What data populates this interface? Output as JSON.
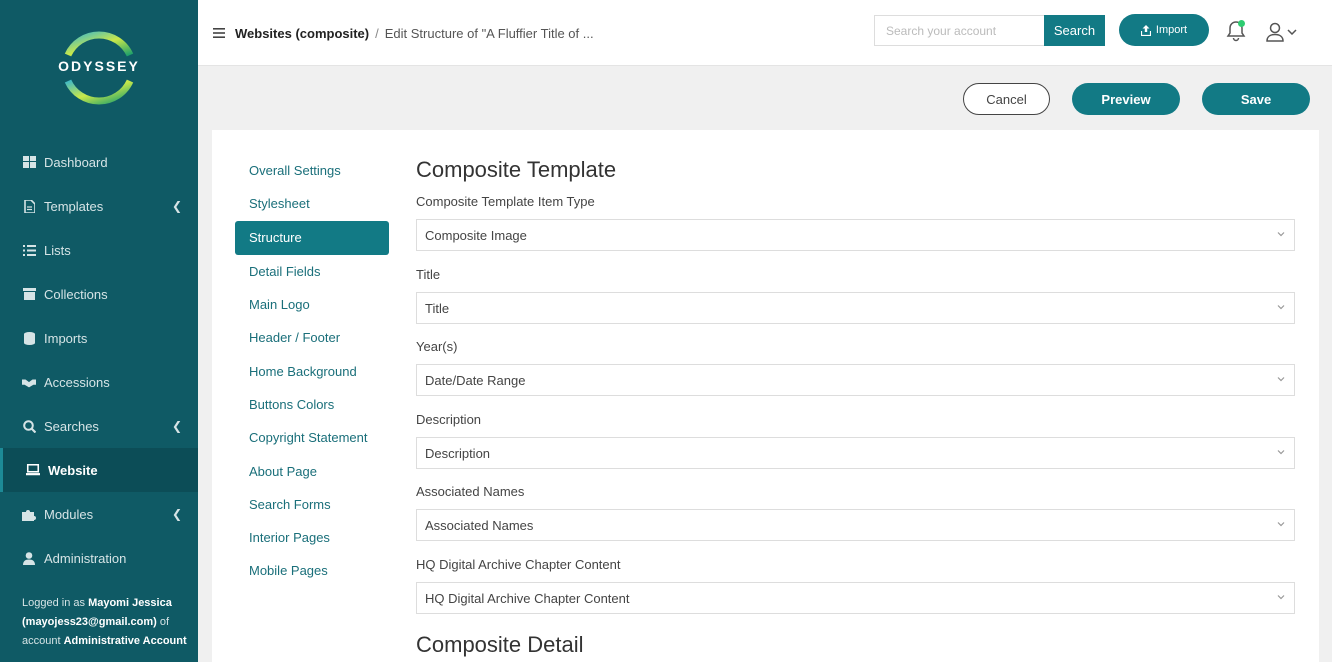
{
  "sidebar": {
    "logo_text": "ODYSSEY",
    "items": [
      {
        "label": "Dashboard",
        "icon": "dashboard-icon",
        "chevron": false,
        "active": false
      },
      {
        "label": "Templates",
        "icon": "file-icon",
        "chevron": true,
        "active": false
      },
      {
        "label": "Lists",
        "icon": "list-icon",
        "chevron": false,
        "active": false
      },
      {
        "label": "Collections",
        "icon": "archive-icon",
        "chevron": false,
        "active": false
      },
      {
        "label": "Imports",
        "icon": "database-icon",
        "chevron": false,
        "active": false
      },
      {
        "label": "Accessions",
        "icon": "handshake-icon",
        "chevron": false,
        "active": false
      },
      {
        "label": "Searches",
        "icon": "search-icon",
        "chevron": true,
        "active": false
      },
      {
        "label": "Website",
        "icon": "laptop-icon",
        "chevron": false,
        "active": true
      },
      {
        "label": "Modules",
        "icon": "puzzle-icon",
        "chevron": true,
        "active": false
      },
      {
        "label": "Administration",
        "icon": "user-icon",
        "chevron": false,
        "active": false
      }
    ],
    "logged_in": {
      "prefix": "Logged in as",
      "name": "Mayomi Jessica",
      "email": "(mayojess23@gmail.com)",
      "of_account": "of account",
      "account": "Administrative Account"
    }
  },
  "topbar": {
    "breadcrumb_root": "Websites (composite)",
    "breadcrumb_separator": "/",
    "breadcrumb_current": "Edit Structure of \"A Fluffier Title of ...",
    "search_placeholder": "Search your account",
    "search_label": "Search",
    "import_label": "Import"
  },
  "actions": {
    "cancel": "Cancel",
    "preview": "Preview",
    "save": "Save"
  },
  "subnav": [
    {
      "label": "Overall Settings",
      "active": false
    },
    {
      "label": "Stylesheet",
      "active": false
    },
    {
      "label": "Structure",
      "active": true
    },
    {
      "label": "Detail Fields",
      "active": false
    },
    {
      "label": "Main Logo",
      "active": false
    },
    {
      "label": "Header / Footer",
      "active": false
    },
    {
      "label": "Home Background",
      "active": false
    },
    {
      "label": "Buttons Colors",
      "active": false
    },
    {
      "label": "Copyright Statement",
      "active": false
    },
    {
      "label": "About Page",
      "active": false
    },
    {
      "label": "Search Forms",
      "active": false
    },
    {
      "label": "Interior Pages",
      "active": false
    },
    {
      "label": "Mobile Pages",
      "active": false
    }
  ],
  "form": {
    "section_title": "Composite Template",
    "fields": [
      {
        "label": "Composite Template Item Type",
        "value": "Composite Image"
      },
      {
        "label": "Title",
        "value": "Title"
      },
      {
        "label": "Year(s)",
        "value": "Date/Date Range"
      },
      {
        "label": "Description",
        "value": "Description"
      },
      {
        "label": "Associated Names",
        "value": "Associated Names"
      },
      {
        "label": "HQ Digital Archive Chapter Content",
        "value": "HQ Digital Archive Chapter Content"
      }
    ],
    "next_section_title": "Composite Detail"
  },
  "colors": {
    "sidebar_bg": "#0f5a65",
    "accent": "#127a85",
    "notification_dot": "#2ecc71"
  }
}
